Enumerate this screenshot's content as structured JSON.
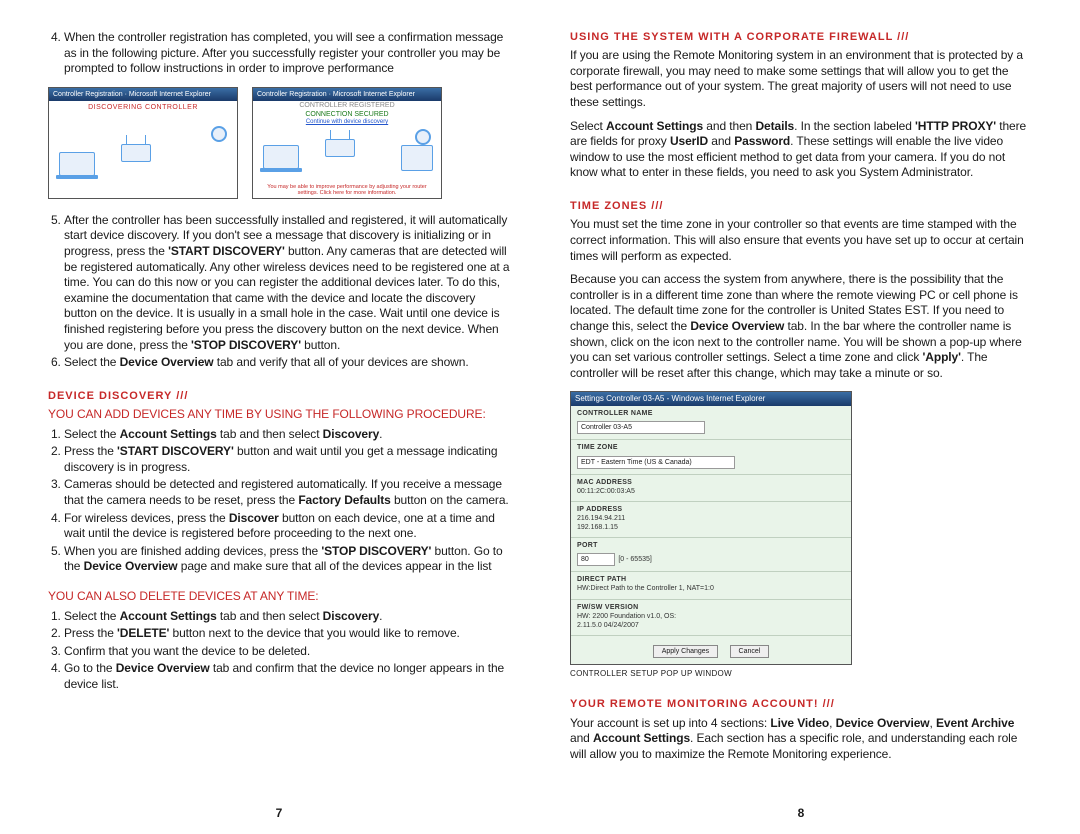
{
  "left": {
    "step4": "When the controller registration has completed, you will see a confirmation message as in the following picture. After you successfully register your controller you may be prompted to follow instructions in order to improve performance",
    "fig1_title": "Controller Registration · Microsoft Internet Explorer",
    "fig1_caption": "DISCOVERING CONTROLLER",
    "fig2_title": "Controller Registration · Microsoft Internet Explorer",
    "fig2_line1": "CONTROLLER REGISTERED",
    "fig2_line2": "CONNECTION SECURED",
    "fig2_link": "Continue with device discovery",
    "fig2_foot": "You may be able to improve performance by adjusting your router settings. Click here for more information.",
    "step5_a": "After the controller has been successfully installed and registered, it will automatically start device discovery. If you don't see a message that discovery is initializing or in progress, press the ",
    "step5_b_bold": "'START DISCOVERY'",
    "step5_c": " button. Any cameras that are detected will be registered automatically. Any other wireless devices need to be registered one at a time. You can do this now or you can register the additional devices later. To do this, examine the documentation that came with the device and locate the discovery button on the device. It is usually in a small hole in the case. Wait until one device is finished registering before you press the discovery button on the next device. When you are done, press the ",
    "step5_d_bold": "'STOP DISCOVERY'",
    "step5_e": " button.",
    "step6_a": "Select the ",
    "step6_b_bold": "Device Overview",
    "step6_c": " tab and verify that all of your devices are shown.",
    "hdr_discovery": "DEVICE DISCOVERY ///",
    "add_sub": "YOU CAN ADD DEVICES ANY TIME BY USING THE FOLLOWING PROCEDURE:",
    "a1_a": "Select the ",
    "a1_b": "Account Settings",
    "a1_c": " tab and then select ",
    "a1_d": "Discovery",
    "a1_e": ".",
    "a2_a": "Press the ",
    "a2_b": "'START DISCOVERY'",
    "a2_c": " button and wait until you get a message indicating discovery is in progress.",
    "a3_a": "Cameras should be detected and registered automatically. If you receive a message that the camera needs to be reset, press the ",
    "a3_b": "Factory Defaults",
    "a3_c": " button on the camera.",
    "a4_a": "For wireless devices, press the ",
    "a4_b": "Discover",
    "a4_c": " button on each device, one at a time and wait until the device is registered before proceeding to the next one.",
    "a5_a": "When you are finished adding devices, press the ",
    "a5_b": "'STOP DISCOVERY'",
    "a5_c": " button. Go to the ",
    "a5_d": "Device Overview",
    "a5_e": " page and make sure that all of the devices appear in the list",
    "del_sub": "YOU CAN ALSO DELETE DEVICES AT ANY TIME:",
    "d1_a": "Select the ",
    "d1_b": "Account Settings",
    "d1_c": " tab and then select ",
    "d1_d": "Discovery",
    "d1_e": ".",
    "d2_a": "Press the ",
    "d2_b": "'DELETE'",
    "d2_c": " button next to the device that you would like to remove.",
    "d3": "Confirm that you want the device to be deleted.",
    "d4_a": "Go to the ",
    "d4_b": "Device Overview",
    "d4_c": " tab and confirm that the device no longer appears in the device list.",
    "page_num": "7"
  },
  "right": {
    "hdr_fw": "USING THE SYSTEM WITH A CORPORATE FIREWALL ///",
    "fw_p1": "If you are using the Remote Monitoring system in an environment that is protected by a corporate firewall, you may need to make some settings that will allow you to get the best performance out of your system. The great majority of users will not need to use these settings.",
    "fw_p2_a": "Select ",
    "fw_p2_b": "Account Settings",
    "fw_p2_c": " and then ",
    "fw_p2_d": "Details",
    "fw_p2_e": ". In the section labeled ",
    "fw_p2_f": "'HTTP PROXY'",
    "fw_p2_g": " there are fields for proxy ",
    "fw_p2_h": "UserID",
    "fw_p2_i": " and ",
    "fw_p2_j": "Password",
    "fw_p2_k": ". These settings will enable the live video window to use the most efficient method to get data from your camera. If you do not know what to enter in these fields, you need to ask you System Administrator.",
    "hdr_tz": "TIME ZONES ///",
    "tz_p1": "You must set the time zone in your controller so that events are time stamped with the correct information. This will also ensure that events you have set up to occur at certain times will perform as expected.",
    "tz_p2_a": "Because you can access the system from anywhere, there is the possibility that the controller is in a different time zone than where the remote viewing PC or cell phone is located. The default time zone for the controller is United States EST. If you need to change this, select the ",
    "tz_p2_b": "Device Overview",
    "tz_p2_c": " tab. In the bar where the controller name is shown, click on the icon next to the controller name. You will be shown a pop-up where you can set various controller settings. Select a time zone and click ",
    "tz_p2_d": "'Apply'",
    "tz_p2_e": ". The controller will be reset after this change, which may take a minute or so.",
    "sb": {
      "title": "Settings Controller 03-A5 - Windows Internet Explorer",
      "name_lbl": "CONTROLLER NAME",
      "name_val": "Controller 03-A5",
      "tz_lbl": "TIME ZONE",
      "tz_val": "EDT - Eastern Time (US & Canada)",
      "mac_lbl": "MAC ADDRESS",
      "mac_val": "00:11:2C:00:03:A5",
      "ip_lbl": "IP ADDRESS",
      "ip_val": "216.194.94.211\n192.168.1.15",
      "port_lbl": "PORT",
      "port_val": "80",
      "port_hint": "[0 - 65535]",
      "dp_lbl": "DIRECT PATH",
      "dp_val": "HW:Direct Path to the Controller 1, NAT=1:0",
      "fw_lbl": "FW/SW VERSION",
      "fw_val": "HW: 2200 Foundation v1.0, OS:\n2.11.5.0 04/24/2007",
      "apply": "Apply Changes",
      "cancel": "Cancel"
    },
    "caption": "CONTROLLER SETUP POP UP WINDOW",
    "hdr_acct": "YOUR REMOTE MONITORING ACCOUNT! ///",
    "acct_a": "Your account is set up into 4 sections: ",
    "acct_b": "Live Video",
    "acct_c": ", ",
    "acct_d": "Device Overview",
    "acct_e": ", ",
    "acct_f": "Event Archive",
    "acct_g": " and ",
    "acct_h": "Account Settings",
    "acct_i": ". Each section has a specific role, and understanding each role will allow you to maximize the Remote Monitoring experience.",
    "page_num": "8"
  }
}
